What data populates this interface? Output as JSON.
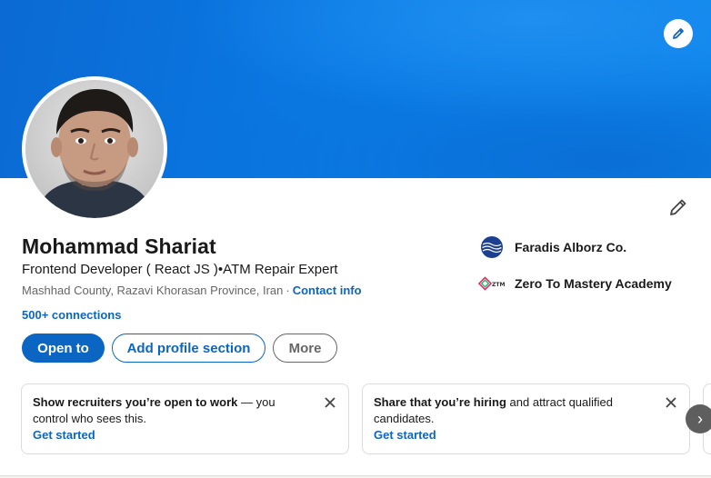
{
  "profile": {
    "name": "Mohammad Shariat",
    "headline": "Frontend Developer ( React JS )•ATM Repair Expert",
    "location": "Mashhad County, Razavi Khorasan Province, Iran",
    "separator": "·",
    "contact_info": "Contact info",
    "connections": "500+ connections"
  },
  "experience": [
    {
      "name": "Faradis Alborz Co.",
      "logo_icon": "wave-globe-logo"
    },
    {
      "name": "Zero To Mastery Academy",
      "logo_icon": "ztm-logo"
    }
  ],
  "actions": {
    "open_to": "Open to",
    "add_section": "Add profile section",
    "more": "More"
  },
  "promos": [
    {
      "bold": "Show recruiters you’re open to work",
      "rest": " — you control who sees this.",
      "link": "Get started"
    },
    {
      "bold": "Share that you’re hiring",
      "rest": " and attract qualified candidates.",
      "link": "Get started"
    }
  ],
  "icons": {
    "banner_edit": "pencil-icon",
    "profile_edit": "pencil-icon",
    "close": "close-icon",
    "next": "chevron-right-icon"
  },
  "colors": {
    "brand_blue": "#0a66c2",
    "banner_blue": "#0a7be6",
    "muted_text": "#666666"
  }
}
